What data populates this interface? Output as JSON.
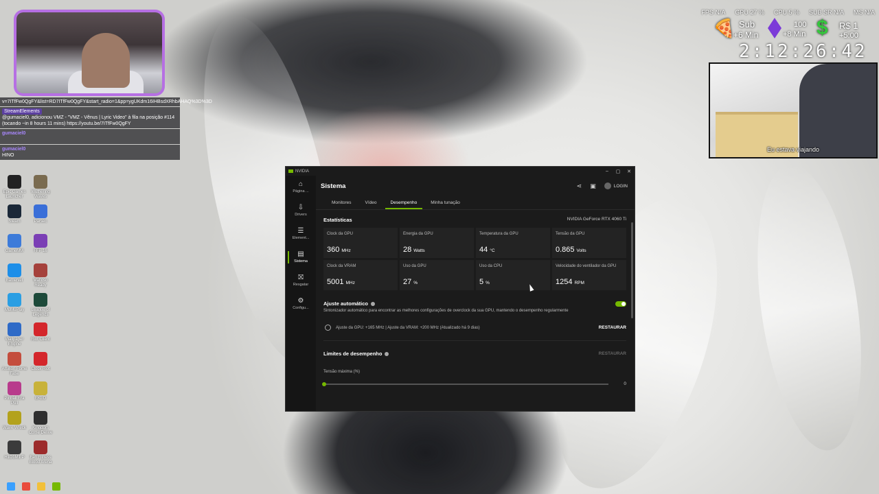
{
  "chat": {
    "url_line": "v=7ITfFw0QgFY&list=RD7ITfFw0QgFY&start_radio=1&pp=ygUKdm16IHBsdXRhbAHAQ%3D%3D",
    "bot_name": "StreamElements",
    "bot_message": "@gumaciel0, adicionou VMZ - \"VMZ - Vênus | Lyric Video\" à fila na posição #114 (tocando ~in 8 hours 11 mins) https://youtu.be/7ITfFw0QgFY",
    "user1": "gumaciel0",
    "user2": "gumaciel0",
    "user2_message": "HINO"
  },
  "topstats": {
    "fps": "FPS N/A",
    "gpu": "GPU 27 %",
    "cpu": "CPU 5 %",
    "sub_sr": "SUB SR N/A",
    "ms": "MS N/A"
  },
  "stream_info": {
    "sub_label": "Sub",
    "sub_min": "+6 Min",
    "count": "100",
    "min8": "+8 Min",
    "currency": "R$ 1",
    "min5": "+5:00",
    "timer": "2:12:26:42"
  },
  "video": {
    "caption": "Eu estava viajando"
  },
  "desktop_icons": [
    {
      "label": "Epic Games Launcher",
      "color": "#222222"
    },
    {
      "label": "Wuthering Waves",
      "color": "#7a6b4f"
    },
    {
      "label": "Steam",
      "color": "#1b2838"
    },
    {
      "label": "Parsec",
      "color": "#3a6fd8"
    },
    {
      "label": "GameMM",
      "color": "#3d7bd9"
    },
    {
      "label": "FFP 16",
      "color": "#7b3fb5"
    },
    {
      "label": "BattleNet",
      "color": "#1d8ee8"
    },
    {
      "label": "Mafioso Ready",
      "color": "#a5413b"
    },
    {
      "label": "MuMuPlay",
      "color": "#2a9ee3"
    },
    {
      "label": "League of Legends",
      "color": "#1d4a3a"
    },
    {
      "label": "Wallpaper Engine",
      "color": "#2e6ac7"
    },
    {
      "label": "Riot Client",
      "color": "#d4262b"
    },
    {
      "label": "Arsilion Fome Fase",
      "color": "#c44d3d"
    },
    {
      "label": "Clock Riot",
      "color": "#d4262b"
    },
    {
      "label": "Pinball Era Pull",
      "color": "#b83b8c"
    },
    {
      "label": "EKLO",
      "color": "#c8b23a"
    },
    {
      "label": "Wave Wreck",
      "color": "#b3a21c"
    },
    {
      "label": "Kingdom Come Delive",
      "color": "#2f2f2f"
    },
    {
      "label": "H1D1M1 P",
      "color": "#3b3b3b"
    },
    {
      "label": "Fab Fitness Blood Arena",
      "color": "#9c2b2b"
    }
  ],
  "taskbar": [
    {
      "name": "windows-start-icon",
      "color": "#3aa0ff"
    },
    {
      "name": "chrome-icon",
      "color": "#e94b3c"
    },
    {
      "name": "file-explorer-icon",
      "color": "#f2c03a"
    },
    {
      "name": "nvidia-app-icon",
      "color": "#76b900"
    }
  ],
  "nvidia": {
    "window_title": "NVIDIA",
    "accent": "#76b900",
    "page_title": "Sistema",
    "login_label": "LOGIN",
    "sidebar": [
      {
        "label": "Página ...",
        "icon": "⌂",
        "name": "home-icon"
      },
      {
        "label": "Drivers",
        "icon": "⇩",
        "name": "drivers-icon"
      },
      {
        "label": "Element...",
        "icon": "☰",
        "name": "graphics-icon"
      },
      {
        "label": "Sistema",
        "icon": "▤",
        "name": "system-icon"
      },
      {
        "label": "Resgatar",
        "icon": "⛝",
        "name": "gift-icon"
      },
      {
        "label": "Configu...",
        "icon": "⚙",
        "name": "gear-icon"
      }
    ],
    "tabs": [
      {
        "label": "Monitores"
      },
      {
        "label": "Vídeo"
      },
      {
        "label": "Desempenho"
      },
      {
        "label": "Minha tunação"
      }
    ],
    "stats_title": "Estatísticas",
    "gpu_model": "NVIDIA GeForce RTX 4060 Ti",
    "stats": [
      {
        "label": "Clock da GPU",
        "value": "360",
        "unit": "MHz"
      },
      {
        "label": "Energia da GPU",
        "value": "28",
        "unit": "Watts"
      },
      {
        "label": "Temperatura da GPU",
        "value": "44",
        "unit": "°C"
      },
      {
        "label": "Tensão da GPU",
        "value": "0.865",
        "unit": "Volts"
      },
      {
        "label": "Clock da VRAM",
        "value": "5001",
        "unit": "MHz"
      },
      {
        "label": "Uso da GPU",
        "value": "27",
        "unit": "%"
      },
      {
        "label": "Uso da CPU",
        "value": "5",
        "unit": "%"
      },
      {
        "label": "Velocidade do ventilador da GPU",
        "value": "1254",
        "unit": "RPM"
      }
    ],
    "auto_tune": {
      "title": "Ajuste automático",
      "enabled": true,
      "description": "Sintonizador automático para encontrar as melhores configurações de overclock da sua GPU, mantendo o desempenho regularmente",
      "info": "Ajuste da GPU: +165 MHz  |  Ajuste da VRAM: +200 MHz (Atualizado há 9 dias)",
      "restore_label": "RESTAURAR"
    },
    "limits": {
      "title": "Limites de desempenho",
      "restore_label": "RESTAURAR",
      "max_voltage_label": "Tensão máxima (%)",
      "max_voltage_value": "0"
    }
  }
}
